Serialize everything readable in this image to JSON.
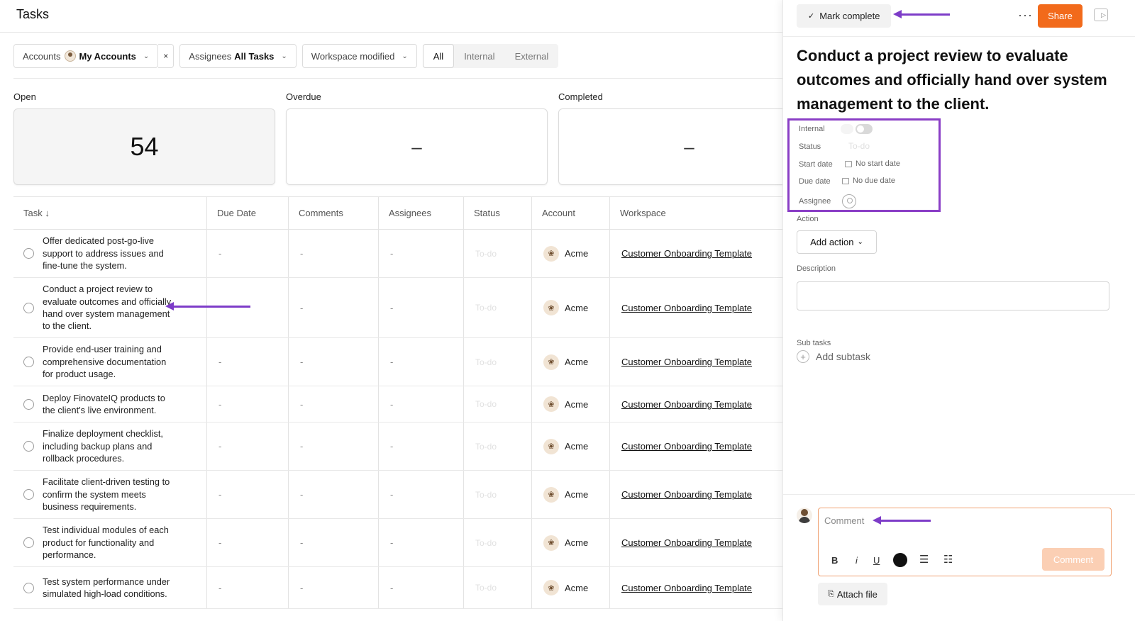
{
  "page": {
    "title": "Tasks"
  },
  "filters": {
    "accounts_label": "Accounts",
    "accounts_value": "My Accounts",
    "assignees_label": "Assignees",
    "assignees_value": "All Tasks",
    "workspace_label": "Workspace modified",
    "clear_symbol": "×",
    "segments": [
      "All",
      "Internal",
      "External"
    ]
  },
  "stats": {
    "open_label": "Open",
    "open_value": "54",
    "overdue_label": "Overdue",
    "overdue_value": "–",
    "completed_label": "Completed",
    "completed_value": "–"
  },
  "table": {
    "headers": [
      "Task ↓",
      "Due Date",
      "Comments",
      "Assignees",
      "Status",
      "Account",
      "Workspace"
    ],
    "rows": [
      {
        "task": "Offer dedicated post-go-live support to address issues and fine-tune the system.",
        "due": "-",
        "comments": "-",
        "assignees": "-",
        "status": "To-do",
        "account": "Acme",
        "workspace": "Customer Onboarding Template"
      },
      {
        "task": "Conduct a project review to evaluate outcomes and officially hand over system management to the client.",
        "due": "",
        "comments": "-",
        "assignees": "-",
        "status": "To-do",
        "account": "Acme",
        "workspace": "Customer Onboarding Template"
      },
      {
        "task": "Provide end-user training and comprehensive documentation for product usage.",
        "due": "-",
        "comments": "-",
        "assignees": "-",
        "status": "To-do",
        "account": "Acme",
        "workspace": "Customer Onboarding Template"
      },
      {
        "task": "Deploy FinovateIQ products to the client's live environment.",
        "due": "-",
        "comments": "-",
        "assignees": "-",
        "status": "To-do",
        "account": "Acme",
        "workspace": "Customer Onboarding Template"
      },
      {
        "task": "Finalize deployment checklist, including backup plans and rollback procedures.",
        "due": "-",
        "comments": "-",
        "assignees": "-",
        "status": "To-do",
        "account": "Acme",
        "workspace": "Customer Onboarding Template"
      },
      {
        "task": "Facilitate client-driven testing to confirm the system meets business requirements.",
        "due": "-",
        "comments": "-",
        "assignees": "-",
        "status": "To-do",
        "account": "Acme",
        "workspace": "Customer Onboarding Template"
      },
      {
        "task": "Test individual modules of each product for functionality and performance.",
        "due": "-",
        "comments": "-",
        "assignees": "-",
        "status": "To-do",
        "account": "Acme",
        "workspace": "Customer Onboarding Template"
      },
      {
        "task": "Test system performance under simulated high-load conditions.",
        "due": "-",
        "comments": "-",
        "assignees": "-",
        "status": "To-do",
        "account": "Acme",
        "workspace": "Customer Onboarding Template"
      }
    ]
  },
  "drawer": {
    "mark_complete": "Mark complete",
    "more": "···",
    "share": "Share",
    "title": "Conduct a project review to evaluate outcomes and officially hand over system management to the client.",
    "props": {
      "internal_label": "Internal",
      "status_label": "Status",
      "status_value": "To-do",
      "start_label": "Start date",
      "start_value": "No start date",
      "due_label": "Due date",
      "due_value": "No due date",
      "assignee_label": "Assignee"
    },
    "action_label": "Action",
    "add_action": "Add action",
    "description_label": "Description",
    "subtasks_label": "Sub tasks",
    "add_subtask": "Add subtask",
    "comment_placeholder": "Comment",
    "comment_submit": "Comment",
    "attach_file": "Attach file",
    "format": {
      "bold": "B",
      "italic": "i",
      "underline": "U"
    }
  },
  "colors": {
    "accent": "#f26a1b",
    "annotation": "#7d3cc8",
    "highlight_border": "#8a3ec6"
  }
}
